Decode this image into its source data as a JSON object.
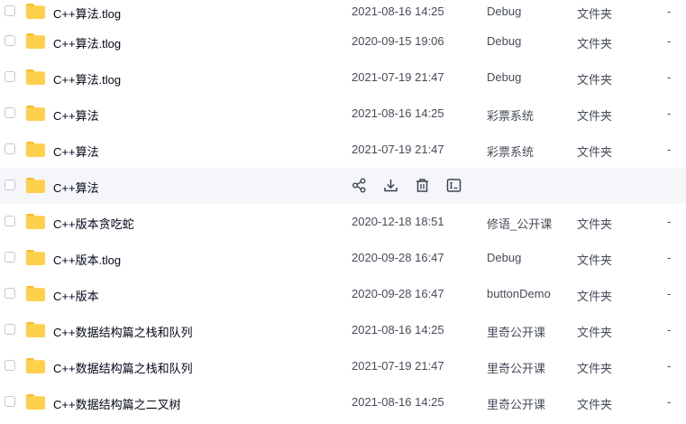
{
  "rows": [
    {
      "name": "C++算法.tlog",
      "date": "2021-08-16 14:25",
      "source": "Debug",
      "type": "文件夹",
      "size": "-"
    },
    {
      "name": "C++算法.tlog",
      "date": "2020-09-15 19:06",
      "source": "Debug",
      "type": "文件夹",
      "size": "-"
    },
    {
      "name": "C++算法.tlog",
      "date": "2021-07-19 21:47",
      "source": "Debug",
      "type": "文件夹",
      "size": "-"
    },
    {
      "name": "C++算法",
      "date": "2021-08-16 14:25",
      "source": "彩票系统",
      "type": "文件夹",
      "size": "-"
    },
    {
      "name": "C++算法",
      "date": "2021-07-19 21:47",
      "source": "彩票系统",
      "type": "文件夹",
      "size": "-"
    },
    {
      "name": "C++算法",
      "date": "",
      "source": "",
      "type": "",
      "size": "",
      "hover": true
    },
    {
      "name": "C++版本贪吃蛇",
      "date": "2020-12-18 18:51",
      "source": "修语_公开课",
      "type": "文件夹",
      "size": "-"
    },
    {
      "name": "C++版本.tlog",
      "date": "2020-09-28 16:47",
      "source": "Debug",
      "type": "文件夹",
      "size": "-"
    },
    {
      "name": "C++版本",
      "date": "2020-09-28 16:47",
      "source": "buttonDemo",
      "type": "文件夹",
      "size": "-"
    },
    {
      "name": "C++数据结构篇之栈和队列",
      "date": "2021-08-16 14:25",
      "source": "里奇公开课",
      "type": "文件夹",
      "size": "-"
    },
    {
      "name": "C++数据结构篇之栈和队列",
      "date": "2021-07-19 21:47",
      "source": "里奇公开课",
      "type": "文件夹",
      "size": "-"
    },
    {
      "name": "C++数据结构篇之二叉树",
      "date": "2021-08-16 14:25",
      "source": "里奇公开课",
      "type": "文件夹",
      "size": "-"
    }
  ],
  "hover_actions": [
    "share-icon",
    "download-icon",
    "delete-icon",
    "rename-icon"
  ],
  "colors": {
    "folder": "#ffd04b",
    "folder_tab": "#f7be2a",
    "hover_bg": "#f5f6fa",
    "icon": "#3b4252"
  }
}
